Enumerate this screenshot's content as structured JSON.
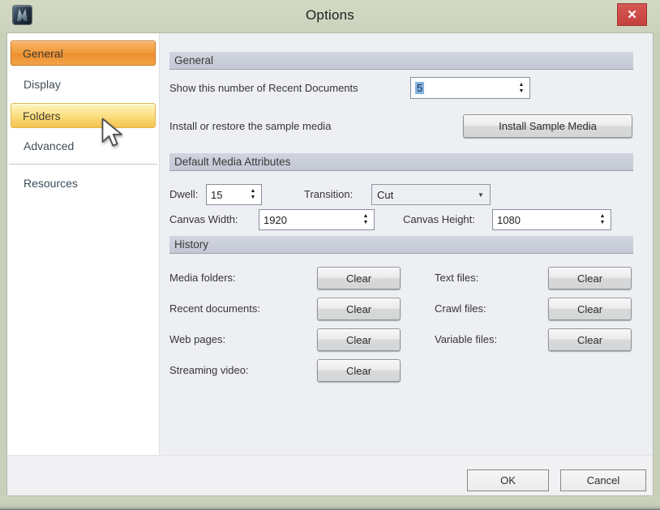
{
  "window": {
    "title": "Options"
  },
  "titlebar": {
    "close_icon": "✕"
  },
  "icons": {
    "spinner_up": "▲",
    "spinner_down": "▼",
    "dropdown_caret": "▼"
  },
  "sidebar": {
    "items": [
      {
        "label": "General",
        "state": "selected"
      },
      {
        "label": "Display",
        "state": "normal"
      },
      {
        "label": "Folders",
        "state": "hover"
      },
      {
        "label": "Advanced",
        "state": "normal"
      },
      {
        "label": "Resources",
        "state": "normal"
      }
    ]
  },
  "general": {
    "header": "General",
    "recent_documents_label": "Show this number of Recent Documents",
    "recent_documents_value": "5",
    "sample_media_label": "Install or restore the sample media",
    "install_sample_media_button": "Install Sample Media"
  },
  "media": {
    "header": "Default Media Attributes",
    "dwell_label": "Dwell:",
    "dwell_value": "15",
    "transition_label": "Transition:",
    "transition_value": "Cut",
    "canvas_width_label": "Canvas Width:",
    "canvas_width_value": "1920",
    "canvas_height_label": "Canvas Height:",
    "canvas_height_value": "1080"
  },
  "history": {
    "header": "History",
    "clear_button_label": "Clear",
    "rows": [
      {
        "left_label": "Media folders:",
        "right_label": "Text files:"
      },
      {
        "left_label": "Recent documents:",
        "right_label": "Crawl files:"
      },
      {
        "left_label": "Web pages:",
        "right_label": "Variable files:"
      },
      {
        "left_label": "Streaming video:",
        "right_label": ""
      }
    ]
  },
  "footer": {
    "ok_label": "OK",
    "cancel_label": "Cancel"
  },
  "colors": {
    "accent_orange": "#f09a3e",
    "hover_yellow": "#f8d066",
    "close_red": "#c4423d",
    "frame_green": "#ccd3be",
    "selection_blue": "#84b1e0"
  }
}
